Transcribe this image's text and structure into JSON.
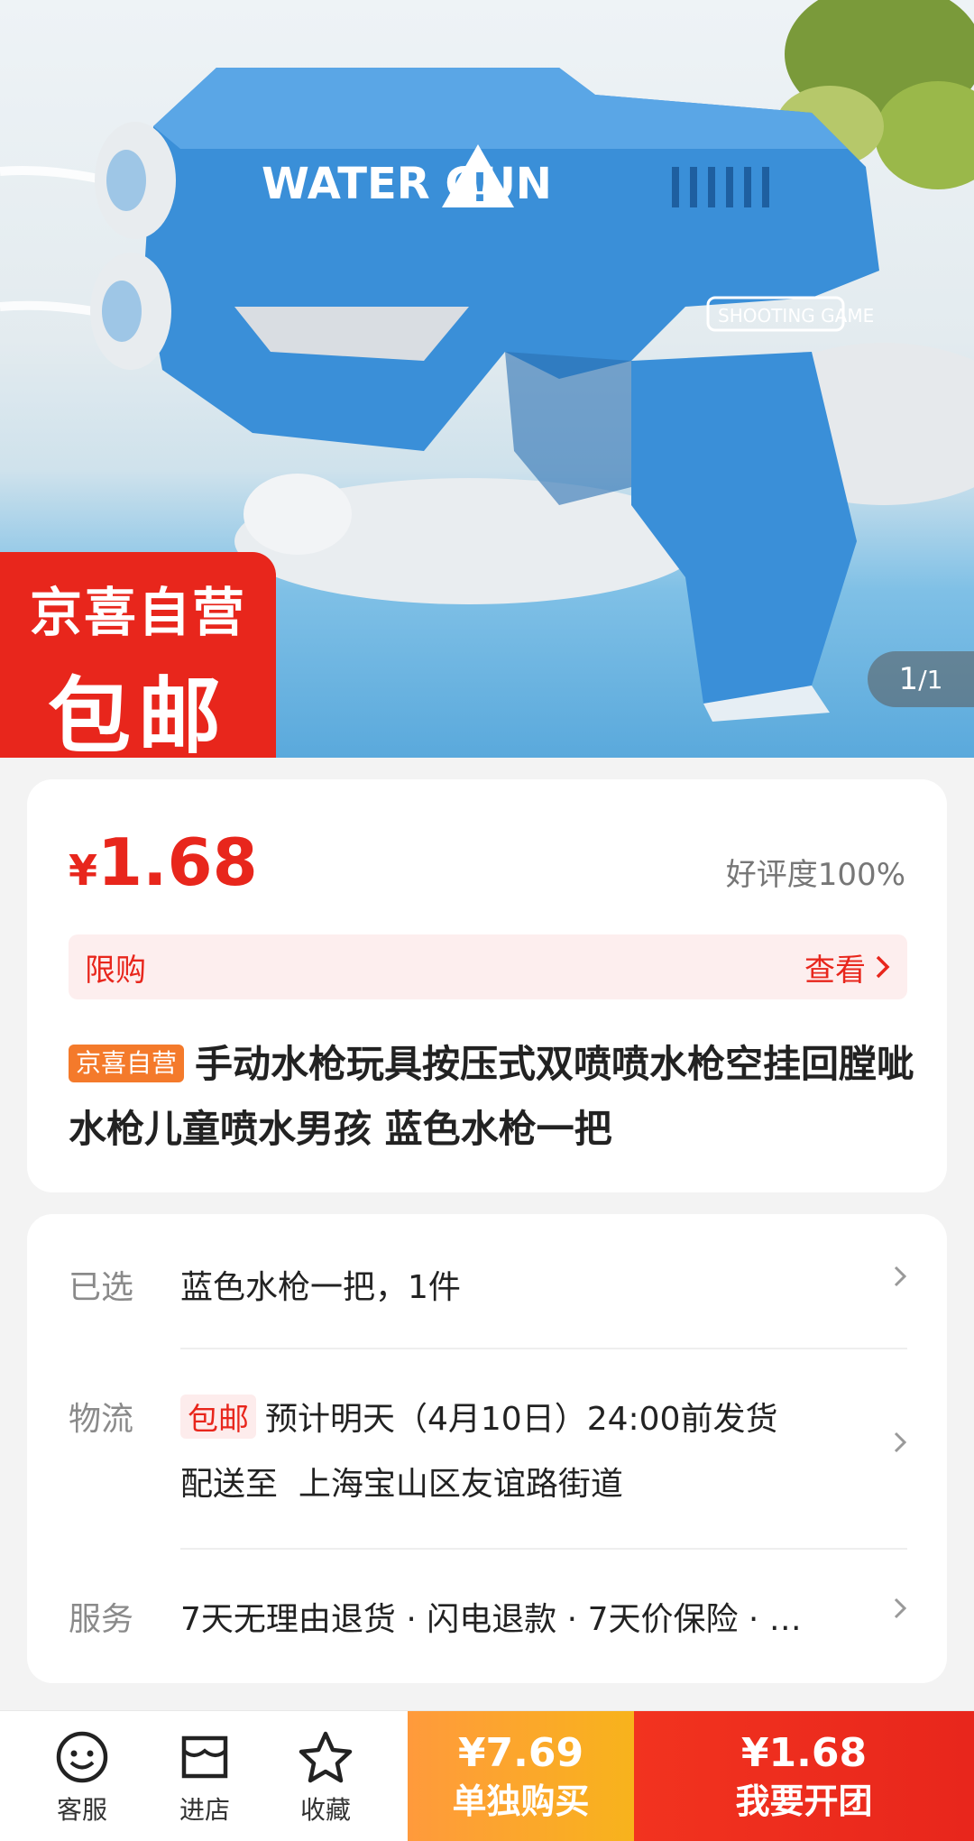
{
  "hero": {
    "gun_text": "WATER GUN",
    "gun_subtext": "SHOOTING GAME",
    "badge_line1": "京喜自营",
    "badge_line2": "包邮",
    "pager_current": "1",
    "pager_total": "/1"
  },
  "product": {
    "price_currency": "¥",
    "price_value": "1.68",
    "rating": "好评度100%",
    "limit_label": "限购",
    "view_label": "查看",
    "tag": "京喜自营",
    "title": "手动水枪玩具按压式双喷喷水枪空挂回膛呲水枪儿童喷水男孩 蓝色水枪一把"
  },
  "details": {
    "selected_label": "已选",
    "selected_value": "蓝色水枪一把，1件",
    "logistics_label": "物流",
    "free_shipping_tag": "包邮",
    "logistics_value": "预计明天（4月10日）24:00前发货",
    "deliver_to_label": "配送至",
    "deliver_to_value": "上海宝山区友谊路街道",
    "service_label": "服务",
    "service_value": "7天无理由退货 · 闪电退款 · 7天价保险 · …"
  },
  "bottom_bar": {
    "service_label": "客服",
    "store_label": "进店",
    "favorite_label": "收藏",
    "single_price": "¥7.69",
    "single_label": "单独购买",
    "group_price": "¥1.68",
    "group_label": "我要开团"
  },
  "colors": {
    "accent_red": "#e8261c",
    "accent_orange": "#f8b31c",
    "gun_blue": "#3a8fd8"
  }
}
